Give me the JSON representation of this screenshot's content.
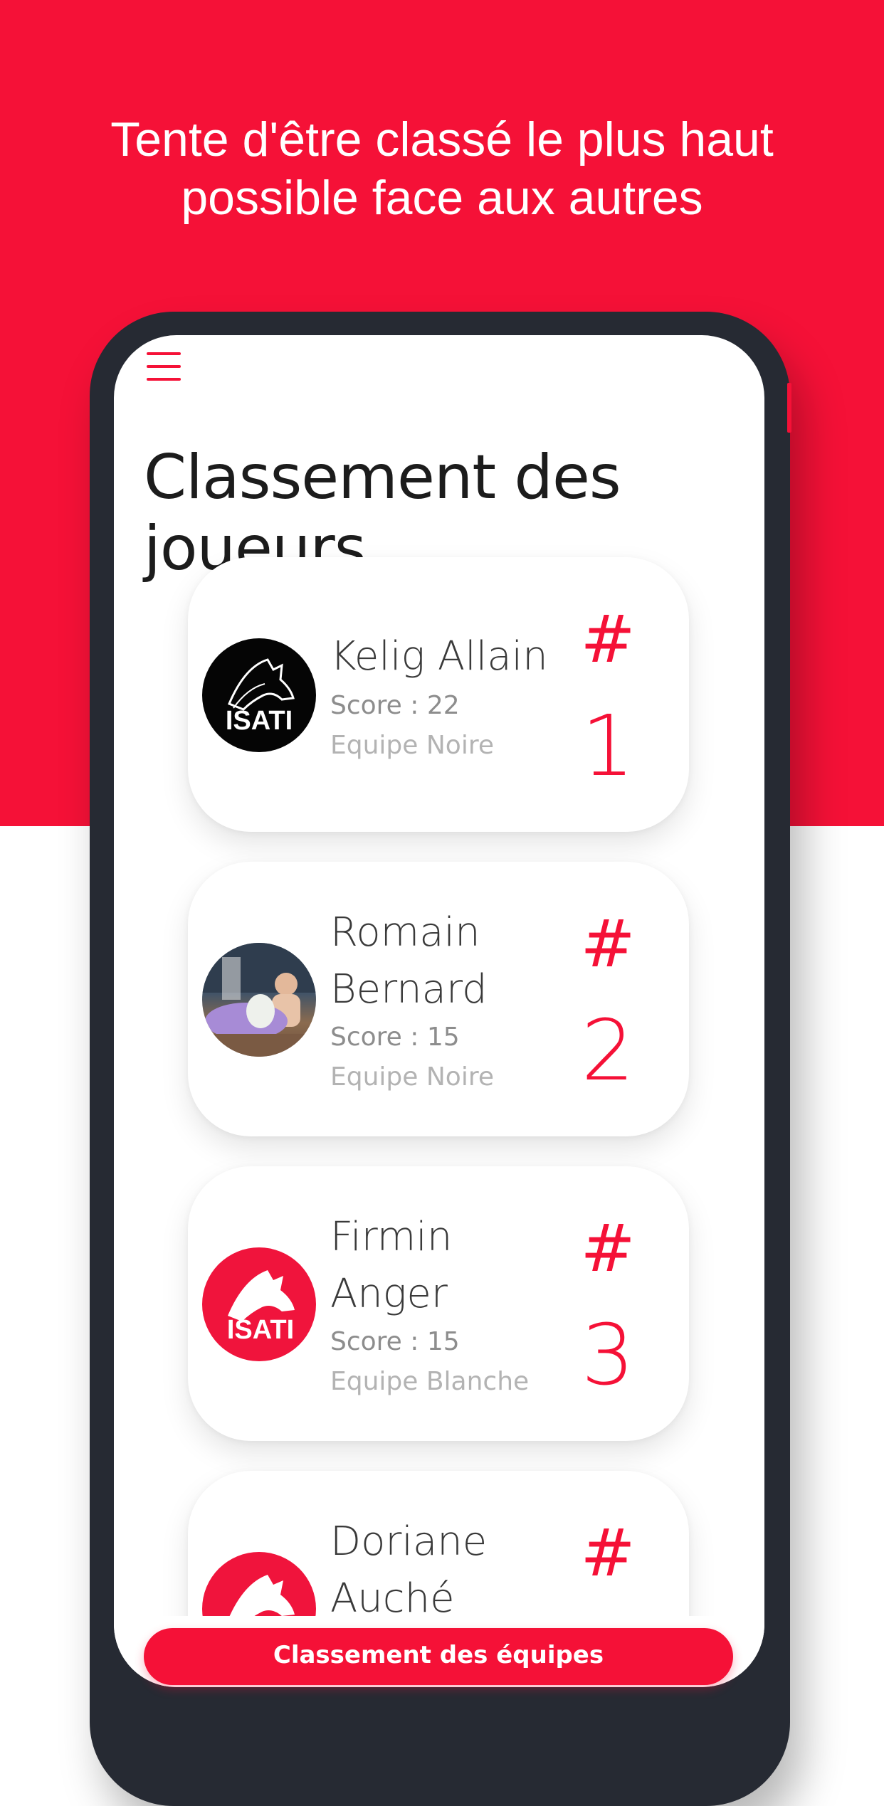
{
  "headline": {
    "line1": "Tente d'être classé le plus haut",
    "line2": "possible face aux autres"
  },
  "app": {
    "menu_icon": "hamburger-menu-icon",
    "title": "Classement des joueurs",
    "players": [
      {
        "name_line1": "Kelig Allain",
        "name_line2": "",
        "score": "Score : 22",
        "team": "Equipe Noire",
        "rank_hash": "#",
        "rank": "1",
        "avatar": "isati-logo-black",
        "avatar_logo_text": "ISATI"
      },
      {
        "name_line1": "Romain",
        "name_line2": "Bernard",
        "score": "Score : 15",
        "team": "Equipe Noire",
        "rank_hash": "#",
        "rank": "2",
        "avatar": "user-photo"
      },
      {
        "name_line1": "Firmin",
        "name_line2": "Anger",
        "score": "Score : 15",
        "team": "Equipe Blanche",
        "rank_hash": "#",
        "rank": "3",
        "avatar": "isati-logo-red",
        "avatar_logo_text": "ISATI"
      },
      {
        "name_line1": "Doriane",
        "name_line2": "Auché",
        "rank_hash": "#",
        "avatar": "isati-logo-red"
      }
    ],
    "teams_button": "Classement des équipes"
  },
  "colors": {
    "accent": "#f51137",
    "phone_frame": "#262a33"
  }
}
